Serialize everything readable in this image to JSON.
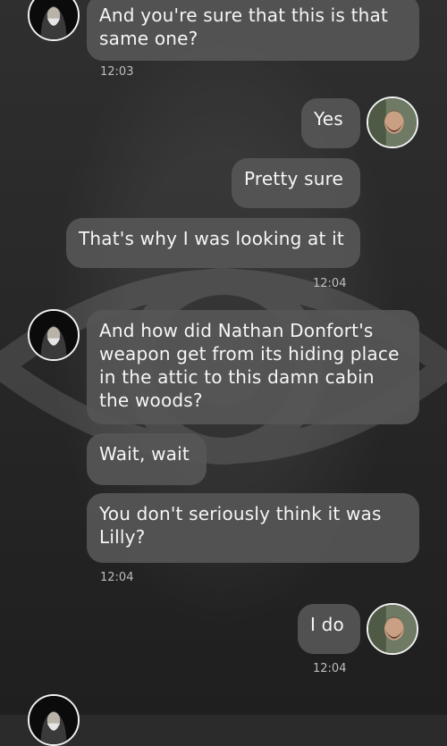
{
  "messages": [
    {
      "text": "And you're sure that this is that same one?",
      "side": "left"
    },
    {
      "text": "Yes",
      "side": "right"
    },
    {
      "text": "Pretty sure",
      "side": "right"
    },
    {
      "text": "That's why I was looking at it",
      "side": "right"
    },
    {
      "text": "And how did Nathan Donfort's weapon get from its hiding place in the attic to this damn cabin the woods?",
      "side": "left"
    },
    {
      "text": "Wait, wait",
      "side": "left"
    },
    {
      "text": "You don't seriously think it was Lilly?",
      "side": "left"
    },
    {
      "text": "I do",
      "side": "right"
    }
  ],
  "timestamps": [
    "12:03",
    "12:04",
    "12:04",
    "12:04"
  ],
  "avatars": {
    "left": "hooded-man-avatar",
    "right": "bearded-man-avatar"
  },
  "colors": {
    "bubble": "#565656",
    "background": "#262626",
    "text": "#f6f6f6",
    "timestamp": "#bdbdbd",
    "avatar_border": "#f2f2f2"
  }
}
